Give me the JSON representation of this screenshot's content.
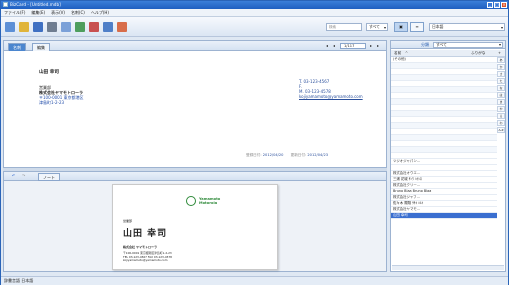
{
  "window": {
    "title": "BizCard - [Untitled.mdb]"
  },
  "menu": {
    "items": [
      "ファイル(F)",
      "編集(E)",
      "表示(V)",
      "名刺(C)",
      "ヘルプ(H)"
    ]
  },
  "toolbar": {
    "search_placeholder": "検索",
    "view_select": "すべて",
    "lang_select": "日本語"
  },
  "tabs": [
    "名刺",
    "編集"
  ],
  "pager": {
    "position": "1/117"
  },
  "card_detail": {
    "name_label": "山田 幸司",
    "company": [
      "営業部",
      "株式会社ヤマモトローラ",
      "〒100-0001 東京都港区",
      "津島町1-2-23"
    ],
    "tel": "T. 03-123-4567",
    "fax": "F.",
    "mobile": "M. 03-123-4578",
    "email": "kojiyamamoto@yamamoto.com",
    "created_label": "登録日付:",
    "created": "2012/04/20",
    "updated_label": "更新日付:",
    "updated": "2012/04/23"
  },
  "lower_tabs": [
    "ノート"
  ],
  "card_image": {
    "dept": "営業部",
    "name": "山田 幸司",
    "company": "株式会社 ヤマモトローラ",
    "addr1": "〒100-0001 東京都港区津島町1-2-23",
    "contact": "TEL 03-123-4567 FAX 03-123-4578",
    "email": "kojiyamamoto@yamamoto.com",
    "logo": "Yamamoto Motorola"
  },
  "right": {
    "group_label": "分類",
    "group_value": "すべて",
    "col_name": "名前",
    "col_furigana": "ふりがな",
    "rows": [
      {
        "t": "(その他)",
        "k": "group"
      },
      {
        "t": "",
        "k": "alt"
      },
      {
        "t": "",
        "k": ""
      },
      {
        "t": "",
        "k": "alt"
      },
      {
        "t": "",
        "k": ""
      },
      {
        "t": "",
        "k": "alt"
      },
      {
        "t": "",
        "k": ""
      },
      {
        "t": "",
        "k": "alt"
      },
      {
        "t": "",
        "k": ""
      },
      {
        "t": "",
        "k": "alt"
      },
      {
        "t": "",
        "k": ""
      },
      {
        "t": "",
        "k": "alt"
      },
      {
        "t": "",
        "k": ""
      },
      {
        "t": "",
        "k": "alt"
      },
      {
        "t": "",
        "k": ""
      },
      {
        "t": "",
        "k": "alt"
      },
      {
        "t": "",
        "k": ""
      },
      {
        "t": "ツジオジャパン...",
        "k": "group"
      },
      {
        "t": "",
        "k": ""
      },
      {
        "t": "株式会社オウエ...",
        "k": "group"
      },
      {
        "t": "三浦 花城     ｻﾝｳ ﾊﾅｼﾛ",
        "k": ""
      },
      {
        "t": "株式会社クリー...",
        "k": "group"
      },
      {
        "t": "Bruno Blaa    Bruno Blaa",
        "k": ""
      },
      {
        "t": "株式会社ジャフ...",
        "k": "group"
      },
      {
        "t": "佐々木 陽翔   ｻｻｷ ﾊﾙﾄ",
        "k": ""
      },
      {
        "t": "株式会社ヤマモ...",
        "k": "group"
      },
      {
        "t": "山田 幸司",
        "k": "sel"
      }
    ],
    "alpha": [
      "あ",
      "か",
      "さ",
      "た",
      "な",
      "は",
      "ま",
      "や",
      "ら",
      "わ",
      "A-Z"
    ]
  },
  "status": {
    "text": "辞書言語 日本語"
  }
}
